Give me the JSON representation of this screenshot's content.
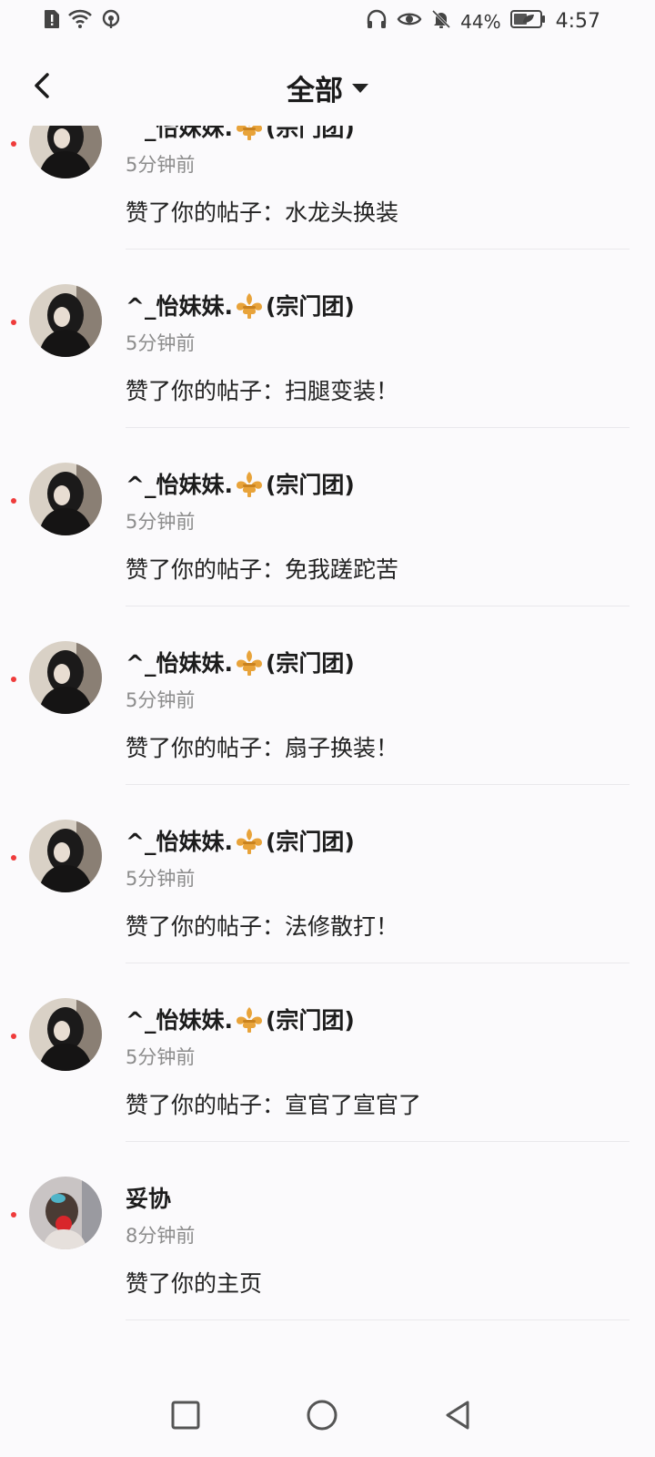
{
  "status_bar": {
    "battery": "44%",
    "time": "4:57",
    "icons": [
      "sim-alert-icon",
      "wifi-icon",
      "hotspot-icon",
      "headphones-icon",
      "eye-icon",
      "bell-off-icon",
      "battery-icon"
    ]
  },
  "header": {
    "title": "全部",
    "back_icon": "chevron-left-icon",
    "dropdown_icon": "caret-down-icon"
  },
  "notifications": [
    {
      "name": "^_怡妹妹.",
      "badge": "(宗门团)",
      "time": "5分钟前",
      "message": "赞了你的帖子：水龙头换装",
      "avatar": "dark"
    },
    {
      "name": "^_怡妹妹.",
      "badge": "(宗门团)",
      "time": "5分钟前",
      "message": "赞了你的帖子：扫腿变装！",
      "avatar": "dark"
    },
    {
      "name": "^_怡妹妹.",
      "badge": "(宗门团)",
      "time": "5分钟前",
      "message": "赞了你的帖子：免我蹉跎苦",
      "avatar": "dark"
    },
    {
      "name": "^_怡妹妹.",
      "badge": "(宗门团)",
      "time": "5分钟前",
      "message": "赞了你的帖子：扇子换装！",
      "avatar": "dark"
    },
    {
      "name": "^_怡妹妹.",
      "badge": "(宗门团)",
      "time": "5分钟前",
      "message": "赞了你的帖子：法修散打！",
      "avatar": "dark"
    },
    {
      "name": "^_怡妹妹.",
      "badge": "(宗门团)",
      "time": "5分钟前",
      "message": "赞了你的帖子：宣官了宣官了",
      "avatar": "dark"
    },
    {
      "name": "妥协",
      "badge": "",
      "time": "8分钟前",
      "message": "赞了你的主页",
      "avatar": "light"
    }
  ],
  "colors": {
    "unread_dot": "#ef3b3b",
    "badge_icon": "#e8a33a",
    "background": "#fbfafc"
  },
  "nav": {
    "recent_icon": "square-icon",
    "home_icon": "circle-icon",
    "back_icon": "triangle-back-icon"
  }
}
